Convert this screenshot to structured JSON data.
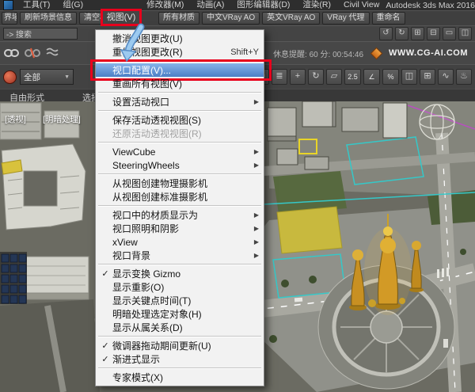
{
  "app": {
    "title": "Autodesk 3ds Max 2016"
  },
  "menu_bar": {
    "view_menu_label": "视图(V)",
    "items": [
      {
        "label": "工具(T)"
      },
      {
        "label": "组(G)"
      },
      {
        "label": "修改器(M)"
      },
      {
        "label": "动画(A)"
      },
      {
        "label": "图形编辑器(D)"
      },
      {
        "label": "渲染(R)"
      },
      {
        "label": "Civil View"
      }
    ]
  },
  "toolbar_scripts": {
    "buttons": [
      "界墙",
      "刷新场景信息",
      "清空材质信息",
      "所有材质",
      "中文VRay AO",
      "英文VRay AO",
      "VRay 代理",
      "重命名"
    ]
  },
  "toolbar_secondary": {
    "search_value": "-> 搜索"
  },
  "toolbar_info": {
    "reminder": "休息提醒: 60 分: 00:54:46",
    "website": "WWW.CG-AI.COM"
  },
  "toolbar_main": {
    "filter_value": "全部",
    "snap_2d_label": "2.5",
    "angle_snap_label": "∠",
    "percent_snap_label": "%"
  },
  "ribbon": {
    "tabs": [
      "自由形式",
      "选择"
    ]
  },
  "viewport": {
    "label_pov": "[透视]",
    "label_shading": "[明暗处理]"
  },
  "view_menu": {
    "items": [
      {
        "label": "撤消视图更改(U)"
      },
      {
        "label": "重做视图更改(R)",
        "shortcut": "Shift+Y"
      },
      {
        "label": "视口配置(V)...",
        "highlighted": true
      },
      {
        "label": "重画所有视图(V)"
      },
      {
        "label": "设置活动视口",
        "submenu": true
      },
      {
        "label": "保存活动透视视图(S)"
      },
      {
        "label": "还原活动透视视图(R)",
        "disabled": true
      },
      {
        "label": "ViewCube",
        "submenu": true
      },
      {
        "label": "SteeringWheels",
        "submenu": true
      },
      {
        "label": "从视图创建物理摄影机"
      },
      {
        "label": "从视图创建标准摄影机"
      },
      {
        "label": "视口中的材质显示为",
        "submenu": true
      },
      {
        "label": "视口照明和阴影",
        "submenu": true
      },
      {
        "label": "xView",
        "submenu": true
      },
      {
        "label": "视口背景",
        "submenu": true
      },
      {
        "label": "显示变换 Gizmo",
        "checked": true
      },
      {
        "label": "显示重影(O)"
      },
      {
        "label": "显示关键点时间(T)"
      },
      {
        "label": "明暗处理选定对象(H)"
      },
      {
        "label": "显示从属关系(D)"
      },
      {
        "label": "微调器拖动期间更新(U)",
        "checked": true
      },
      {
        "label": "渐进式显示",
        "checked": true
      },
      {
        "label": "专家模式(X)"
      }
    ]
  },
  "icons": {
    "submenu_arrow": "▶",
    "checkmark": "✓",
    "dropdown_arrow": "▼"
  },
  "colors": {
    "annotation_red": "#e8001c",
    "annotation_arrow_blue": "#9ccaf0",
    "menu_highlight": "#4c7fc6",
    "statue_gold": "#d29a26"
  }
}
